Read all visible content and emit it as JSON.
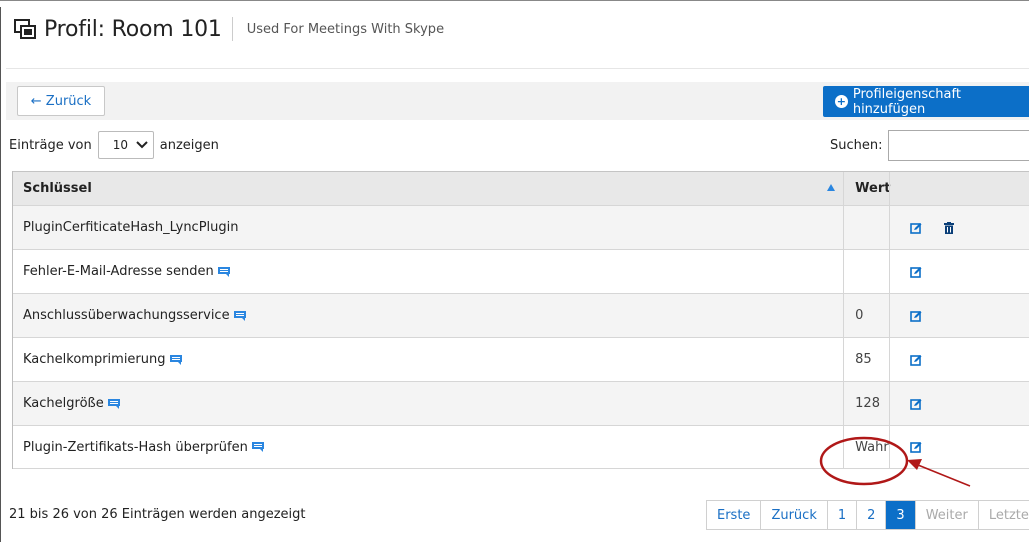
{
  "header": {
    "title": "Profil: Room 101",
    "subtitle": "Used For Meetings With Skype"
  },
  "toolbar": {
    "back_label": "← Zurück",
    "add_label": "Profileigenschaft hinzufügen",
    "accent_color": "#0c6fc8"
  },
  "controls": {
    "entries_prefix": "Einträge von",
    "entries_value": "10",
    "entries_suffix": "anzeigen",
    "search_label": "Suchen:",
    "search_value": ""
  },
  "table": {
    "columns": [
      "Schlüssel",
      "Wert",
      ""
    ],
    "rows": [
      {
        "key": "PluginCerfiticateHash_LyncPlugin",
        "value": "",
        "has_comment": false,
        "has_delete": true
      },
      {
        "key": "Fehler-E-Mail-Adresse senden",
        "value": "",
        "has_comment": true,
        "has_delete": false
      },
      {
        "key": "Anschlussüberwachungsservice",
        "value": "0",
        "has_comment": true,
        "has_delete": false
      },
      {
        "key": "Kachelkomprimierung",
        "value": "85",
        "has_comment": true,
        "has_delete": false
      },
      {
        "key": "Kachelgröße",
        "value": "128",
        "has_comment": true,
        "has_delete": false
      },
      {
        "key": "Plugin-Zertifikats-Hash überprüfen",
        "value": "Wahr",
        "has_comment": true,
        "has_delete": false
      }
    ]
  },
  "footer": {
    "info": "21 bis 26 von 26 Einträgen werden angezeigt",
    "pager": [
      "Erste",
      "Zurück",
      "1",
      "2",
      "3",
      "Weiter",
      "Letzte"
    ],
    "active_page": "3"
  },
  "annotation": {
    "highlight_color": "#b01818"
  }
}
